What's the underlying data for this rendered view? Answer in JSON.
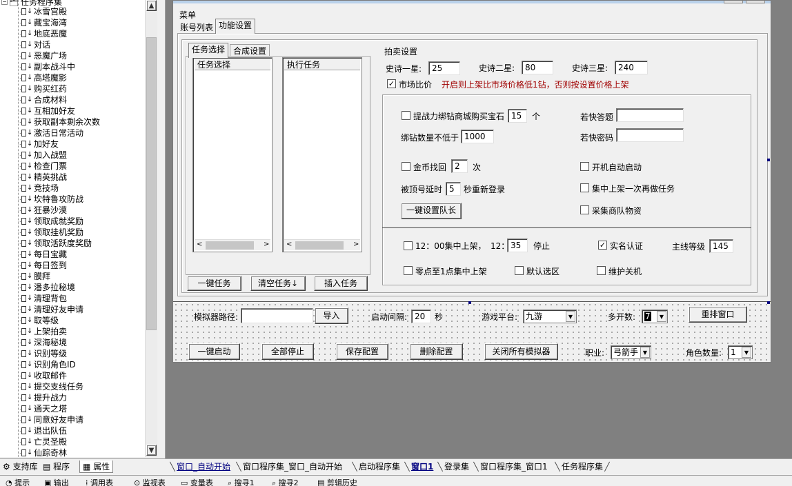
{
  "tree": {
    "root": "任务程序集",
    "items": [
      "冰雪宫殿",
      "藏宝海湾",
      "地底恶魔",
      "对话",
      "恶魔广场",
      "副本战斗中",
      "高塔魔影",
      "购买红药",
      "合成材料",
      "互相加好友",
      "获取副本剩余次数",
      "激活日常活动",
      "加好友",
      "加入战盟",
      "检查门票",
      "精英挑战",
      "竞技场",
      "坎特鲁攻防战",
      "狂暴沙漠",
      "领取成就奖励",
      "领取挂机奖励",
      "领取活跃度奖励",
      "每日宝藏",
      "每日签到",
      "膜拜",
      "潘多拉秘境",
      "清理背包",
      "清理好友申请",
      "取等级",
      "上架拍卖",
      "深海秘境",
      "识别等级",
      "识别角色ID",
      "收取邮件",
      "提交支线任务",
      "提升战力",
      "通天之塔",
      "同意好友申请",
      "退出队伍",
      "亡灵圣殿",
      "仙踪奇林"
    ]
  },
  "left_tabs": [
    "支持库",
    "程序",
    "属性"
  ],
  "doc_tabs": [
    "窗口_自动开始",
    "窗口程序集_窗口_自动开始",
    "启动程序集",
    "窗口1",
    "登录集",
    "窗口程序集_窗口1",
    "任务程序集"
  ],
  "status_tabs": [
    "提示",
    "输出",
    "调用表",
    "监视表",
    "变量表",
    "搜寻1",
    "搜寻2",
    "剪辑历史"
  ],
  "form": {
    "menu": "菜单",
    "tabs": [
      "账号列表",
      "功能设置"
    ],
    "inner_tabs": [
      "任务选择",
      "合成设置"
    ],
    "list_left_header": "任务选择",
    "list_right_header": "执行任务",
    "btn_one_key_task": "一键任务",
    "btn_clear_task": "清空任务↓",
    "btn_insert_task": "插入任务",
    "auction": {
      "title": "拍卖设置",
      "epic1_label": "史诗一星:",
      "epic1_value": "25",
      "epic2_label": "史诗二星:",
      "epic2_value": "80",
      "epic3_label": "史诗三星:",
      "epic3_value": "240",
      "market_label": "市场比价",
      "market_checked": true,
      "market_note": "开启则上架比市场价格低1钻，否则按设置价格上架"
    },
    "opts": {
      "buy_gem_label": "提战力绑钻商城购买宝石",
      "buy_gem_value": "15",
      "buy_gem_unit": "个",
      "min_bind_label": "绑钻数量不低于",
      "min_bind_value": "1000",
      "ruokuai_q_label": "若快答题",
      "ruokuai_q_value": "",
      "ruokuai_p_label": "若快密码",
      "ruokuai_p_value": "",
      "gold_back_label": "金币找回",
      "gold_back_value": "2",
      "gold_back_unit": "次",
      "auto_start_label": "开机自动启动",
      "relogin_label": "被顶号延时",
      "relogin_value": "5",
      "relogin_unit": "秒重新登录",
      "central_label": "集中上架一次再做任务",
      "team_btn": "一键设置队长",
      "collect_label": "采集商队物资"
    },
    "bottom": {
      "noon_label": "12：00集中上架，",
      "noon_time_label": "12：",
      "noon_time_value": "35",
      "noon_stop": "停止",
      "realname_label": "实名认证",
      "realname_checked": true,
      "level_label": "主线等级",
      "level_value": "145",
      "midnight_label": "零点至1点集中上架",
      "default_zone_label": "默认选区",
      "maintain_label": "维护关机"
    },
    "footer": {
      "path_label": "模拟器路径:",
      "path_value": "",
      "import_btn": "导入",
      "interval_label": "启动间隔:",
      "interval_value": "20",
      "interval_unit": "秒",
      "platform_label": "游戏平台:",
      "platform_value": "九游",
      "multi_label": "多开数:",
      "multi_value": "7",
      "rearrange_btn": "重排窗口",
      "start_all_btn": "一键启动",
      "stop_all_btn": "全部停止",
      "save_btn": "保存配置",
      "delete_btn": "删除配置",
      "close_sims_btn": "关闭所有模拟器",
      "job_label": "职业:",
      "job_value": "弓箭手",
      "role_count_label": "角色数量:",
      "role_count_value": "1"
    }
  },
  "colors": {
    "note_red": "#a00000",
    "handle": "#000080",
    "selected_tab_link": "#000080"
  }
}
